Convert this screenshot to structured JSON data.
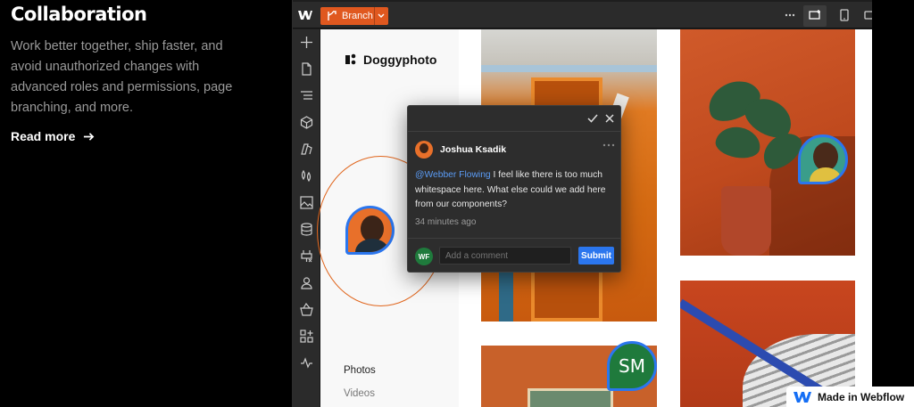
{
  "hero": {
    "title": "Collaboration",
    "description": "Work better together, ship faster, and avoid unauthorized changes with advanced roles and permissions, page branching, and more.",
    "cta_label": "Read more"
  },
  "designer": {
    "branch_label": "Branch",
    "site": {
      "brand": "Doggyphoto",
      "nav": [
        "Photos",
        "Videos"
      ]
    },
    "comment": {
      "author": "Joshua Ksadik",
      "mention": "@Webber Flowing",
      "body": " I feel like there is too much whitespace here. What else could we add here from our components?",
      "time": "34 minutes ago",
      "reply_avatar": "WF",
      "input_placeholder": "Add a comment",
      "submit_label": "Submit"
    },
    "presence_initials": "SM"
  },
  "badge": {
    "label": "Made in Webflow"
  },
  "colors": {
    "accent_orange": "#e0581f",
    "accent_blue": "#2b76ee",
    "presence_green": "#1f7a3c"
  },
  "icons": [
    "webflow-logo-icon",
    "branch-icon",
    "chevron-down-icon",
    "more-icon",
    "desktop-icon",
    "tablet-icon",
    "add-icon",
    "pages-icon",
    "navigator-icon",
    "components-icon",
    "styles-icon",
    "variables-icon",
    "assets-icon",
    "cms-icon",
    "apps-icon",
    "users-icon",
    "ecommerce-icon",
    "integrations-icon",
    "activity-icon",
    "check-icon",
    "close-icon",
    "arrow-right-icon"
  ]
}
